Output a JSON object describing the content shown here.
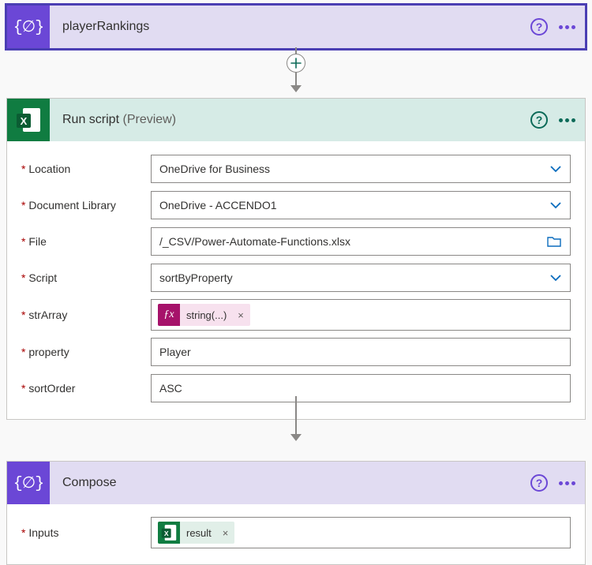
{
  "card1": {
    "title": "playerRankings"
  },
  "card2": {
    "title": "Run script",
    "suffix": "(Preview)",
    "labels": {
      "location": "Location",
      "documentLibrary": "Document Library",
      "file": "File",
      "script": "Script",
      "strArray": "strArray",
      "property": "property",
      "sortOrder": "sortOrder"
    },
    "values": {
      "location": "OneDrive for Business",
      "documentLibrary": "OneDrive - ACCENDO1",
      "file": "/_CSV/Power-Automate-Functions.xlsx",
      "script": "sortByProperty",
      "strArrayToken": "string(...)",
      "property": "Player",
      "sortOrder": "ASC"
    }
  },
  "card3": {
    "title": "Compose",
    "labels": {
      "inputs": "Inputs"
    },
    "values": {
      "token": "result"
    }
  }
}
